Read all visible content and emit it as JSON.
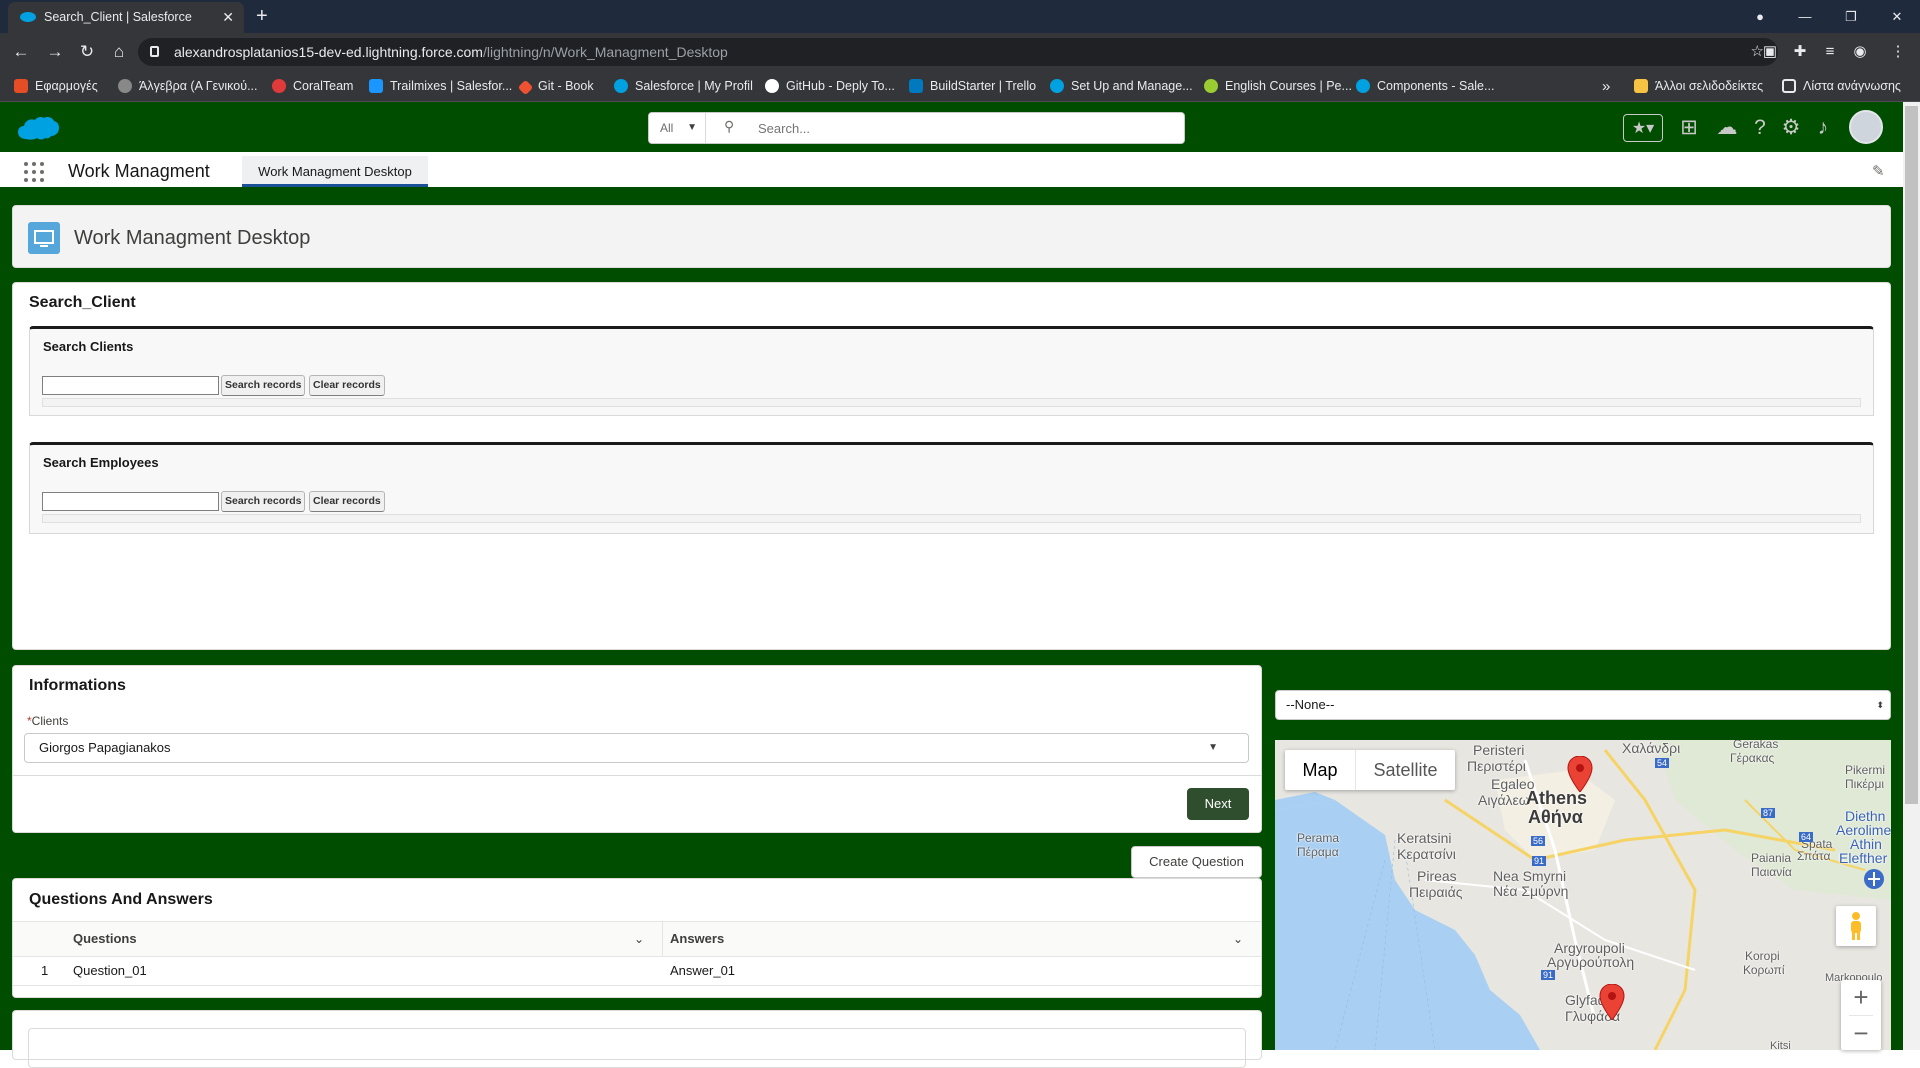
{
  "browser": {
    "tab_title": "Search_Client | Salesforce",
    "tab_close": "✕",
    "new_tab": "+",
    "url_host": "alexandrosplatanios15-dev-ed.lightning.force.com",
    "url_path": "/lightning/n/Work_Managment_Desktop",
    "bookmarks": [
      "Εφαρμογές",
      "Άλγεβρα (Α Γενικού...",
      "CoralTeam",
      "Trailmixes | Salesfor...",
      "Git - Book",
      "Salesforce | My Profil",
      "GitHub - Deply To...",
      "BuildStarter | Trello",
      "Set Up and Manage...",
      "English Courses | Pe...",
      "Components - Sale..."
    ],
    "bookmarks_more": "»",
    "other_bookmarks": "Άλλοι σελιδοδείκτες",
    "reading_list": "Λίστα ανάγνωσης"
  },
  "sf": {
    "search_scope": "All",
    "search_placeholder": "Search...",
    "app_name": "Work Managment",
    "app_tab": "Work Managment Desktop",
    "page_title": "Work Managment Desktop",
    "brand_color": "#004d00"
  },
  "search_card": {
    "title": "Search_Client",
    "clients_block": {
      "title": "Search Clients",
      "search_btn": "Search records",
      "clear_btn": "Clear records"
    },
    "employees_block": {
      "title": "Search Employees",
      "search_btn": "Search records",
      "clear_btn": "Clear records"
    }
  },
  "informations": {
    "title": "Informations",
    "required_mark": "*",
    "client_label": "Clients",
    "client_value": "Giorgos Papagianakos",
    "next_button": "Next"
  },
  "create_question_button": "Create Question",
  "qa": {
    "title": "Questions And Answers",
    "columns": [
      "Questions",
      "Answers"
    ],
    "rows": [
      {
        "num": "1",
        "question": "Question_01",
        "answer": "Answer_01"
      }
    ]
  },
  "right": {
    "select_value": "--None--"
  },
  "map": {
    "type_map": "Map",
    "type_satellite": "Satellite",
    "labels": [
      "Peristeri",
      "Περιστέρι",
      "Egaleo",
      "Αιγάλεω",
      "Athens",
      "Αθήνα",
      "Χαλάνδρι",
      "Gerakas",
      "Γέρακας",
      "Pikermi",
      "Πικέρμι",
      "Perama",
      "Πέραμα",
      "Keratsini",
      "Κερατσίνι",
      "Pireas",
      "Πειραιάς",
      "Nea Smyrni",
      "Νέα Σμύρνη",
      "Paiania",
      "Παιανία",
      "Spata",
      "Σπάτα",
      "Diethn",
      "Aerolime",
      "Athin",
      "Elefther",
      "Argyroupoli",
      "Αργυρούπολη",
      "Koropi",
      "Κορωπί",
      "Glyfada",
      "Γλυφάδα",
      "Markopoulo",
      "Kitsi"
    ],
    "road_numbers": [
      "54",
      "56",
      "91",
      "87",
      "64",
      "91"
    ],
    "zoom_in": "+",
    "zoom_out": "−"
  }
}
